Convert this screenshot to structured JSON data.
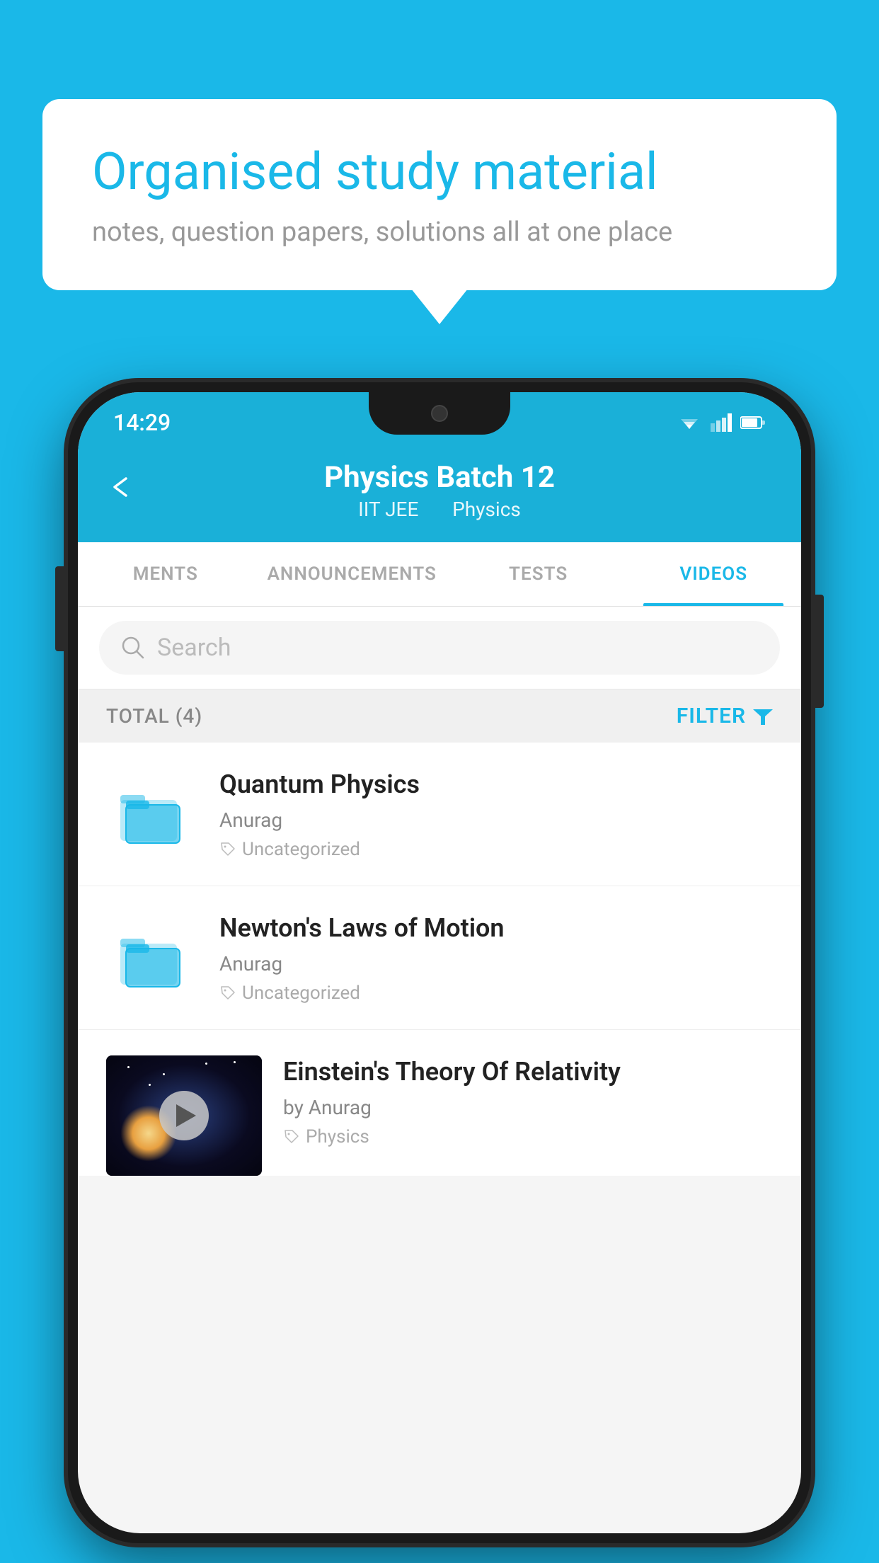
{
  "background_color": "#1ab8e8",
  "speech_bubble": {
    "title": "Organised study material",
    "subtitle": "notes, question papers, solutions all at one place"
  },
  "status_bar": {
    "time": "14:29"
  },
  "header": {
    "title": "Physics Batch 12",
    "subtitle_part1": "IIT JEE",
    "subtitle_part2": "Physics",
    "back_label": "←"
  },
  "tabs": [
    {
      "label": "MENTS",
      "active": false
    },
    {
      "label": "ANNOUNCEMENTS",
      "active": false
    },
    {
      "label": "TESTS",
      "active": false
    },
    {
      "label": "VIDEOS",
      "active": true
    }
  ],
  "search": {
    "placeholder": "Search"
  },
  "filter_bar": {
    "total_label": "TOTAL (4)",
    "filter_label": "FILTER"
  },
  "video_items": [
    {
      "title": "Quantum Physics",
      "author": "Anurag",
      "tag": "Uncategorized",
      "type": "folder"
    },
    {
      "title": "Newton's Laws of Motion",
      "author": "Anurag",
      "tag": "Uncategorized",
      "type": "folder"
    },
    {
      "title": "Einstein's Theory Of Relativity",
      "author": "by Anurag",
      "tag": "Physics",
      "type": "video"
    }
  ]
}
